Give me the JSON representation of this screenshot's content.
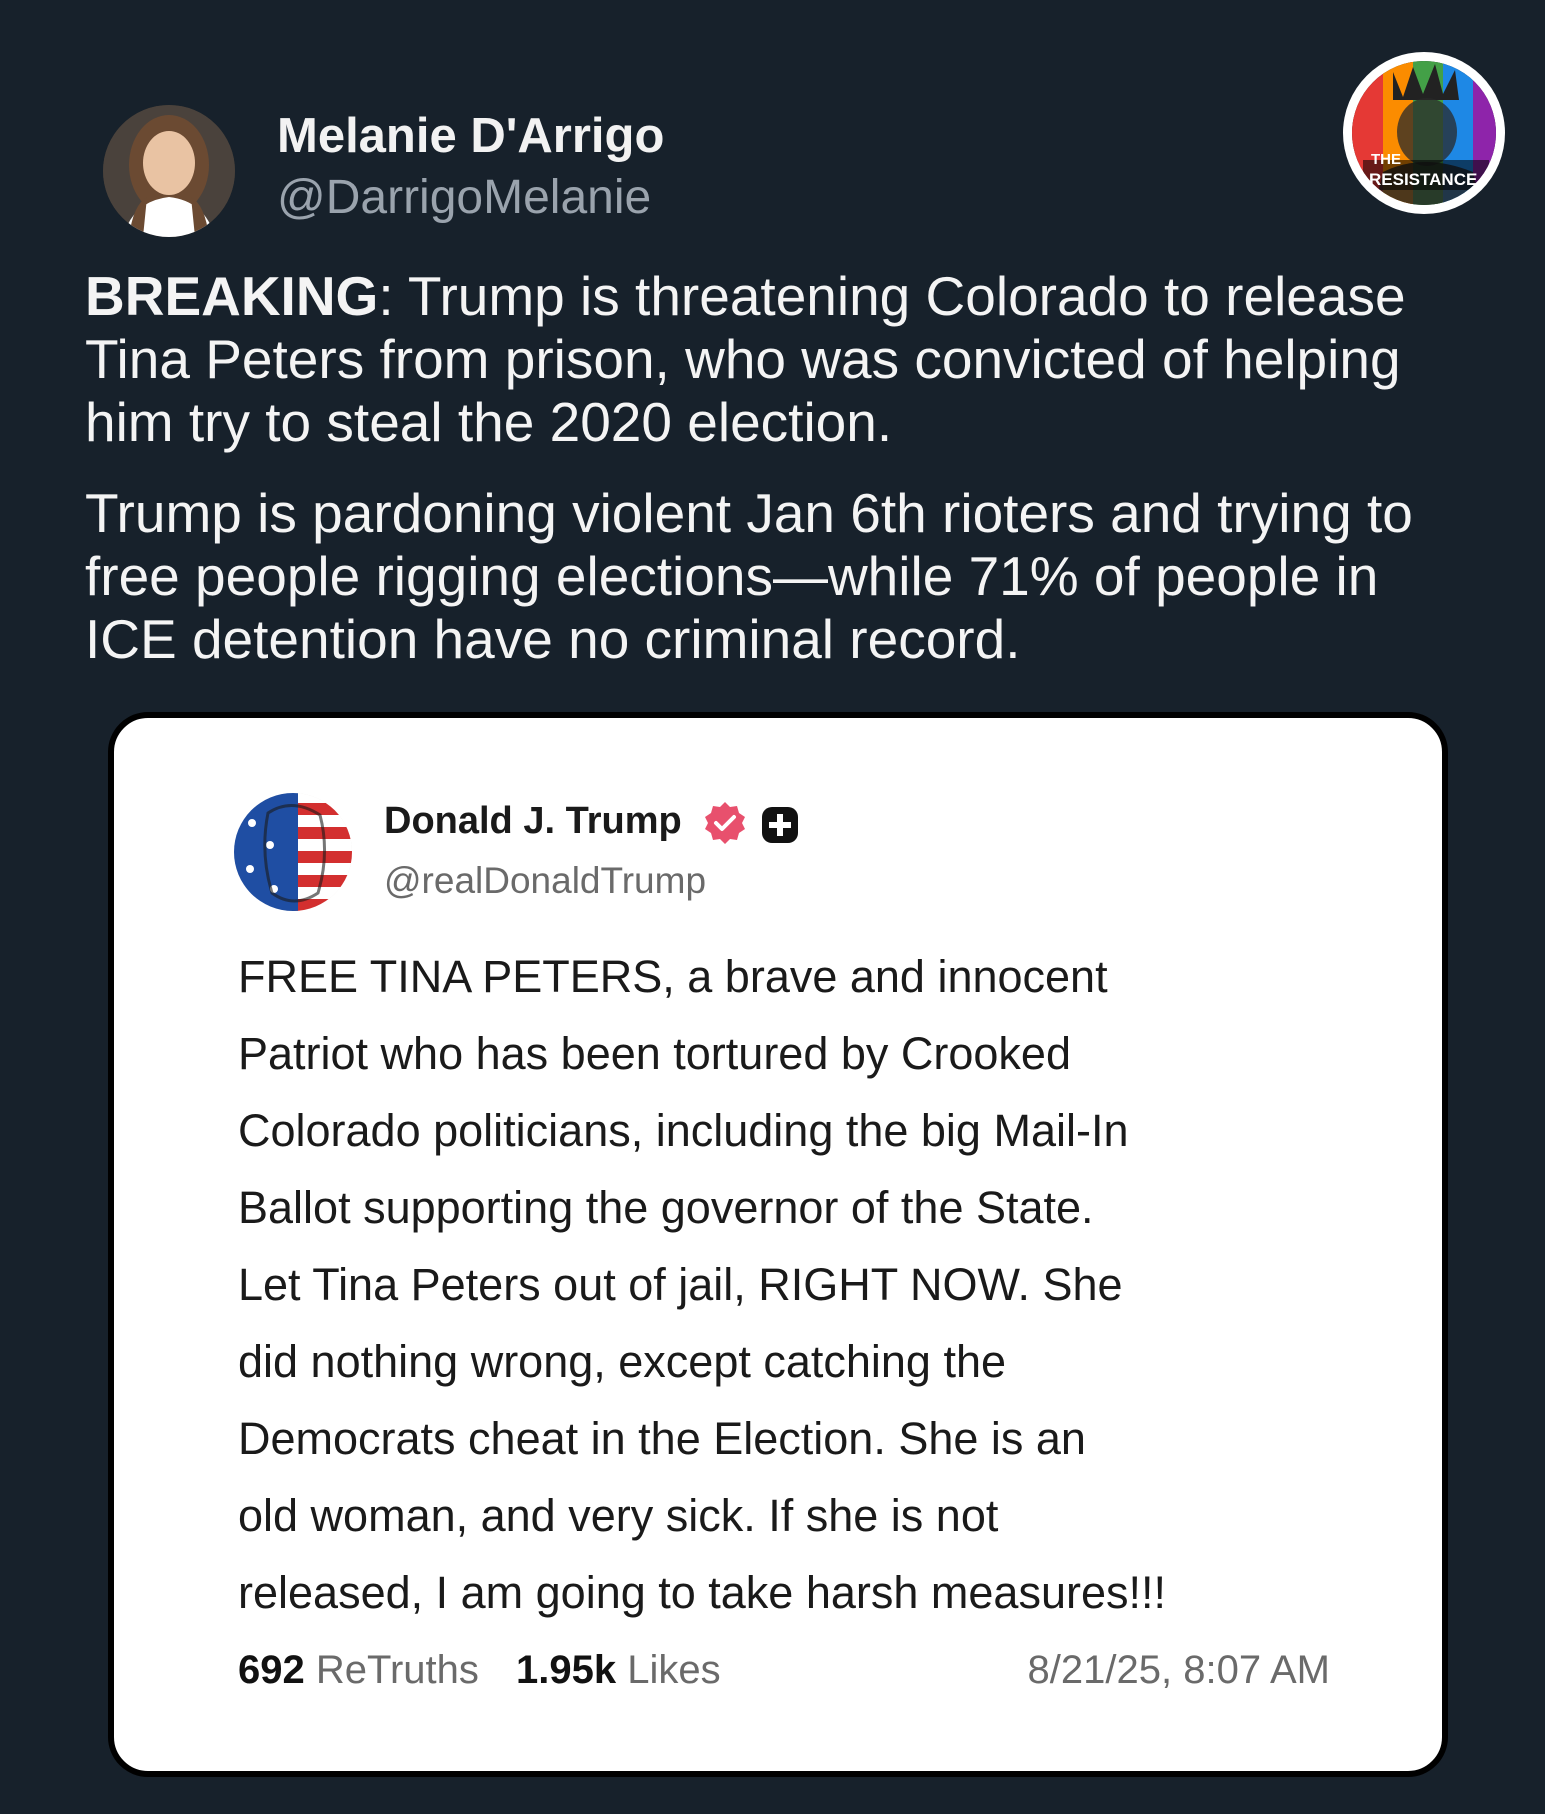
{
  "post": {
    "author_name": "Melanie D'Arrigo",
    "author_handle": "@DarrigoMelanie",
    "text_label": "BREAKING",
    "text_part1": ": Trump is threatening Colorado to release Tina Peters from prison, who was convicted of helping him try to steal the 2020 election.",
    "text_part2": "Trump is pardoning violent Jan 6th rioters and trying to free people rigging elections—while 71% of people in ICE detention have no criminal record."
  },
  "badge": {
    "line1": "THE",
    "line2": "RESISTANCE"
  },
  "embedded_post": {
    "author_name": "Donald J. Trump",
    "author_handle": "@realDonaldTrump",
    "verified_icon": "verified-badge-icon",
    "extra_icon": "plus-square-icon",
    "verified_color": "#e8506d",
    "body": "FREE TINA PETERS, a brave and innocent\nPatriot who has been tortured by Crooked\nColorado politicians, including the big Mail-In\nBallot supporting the governor of the State.\nLet Tina Peters out of jail, RIGHT NOW. She\ndid nothing wrong, except catching the\nDemocrats cheat in the   Election. She is an\nold woman, and very sick. If she is not\nreleased, I am going to take harsh measures!!!",
    "retruths_count": "692",
    "retruths_label": "ReTruths",
    "likes_count": "1.95k",
    "likes_label": "Likes",
    "timestamp": "8/21/25, 8:07 AM"
  },
  "colors": {
    "background": "#17212b",
    "card": "#ffffff"
  }
}
